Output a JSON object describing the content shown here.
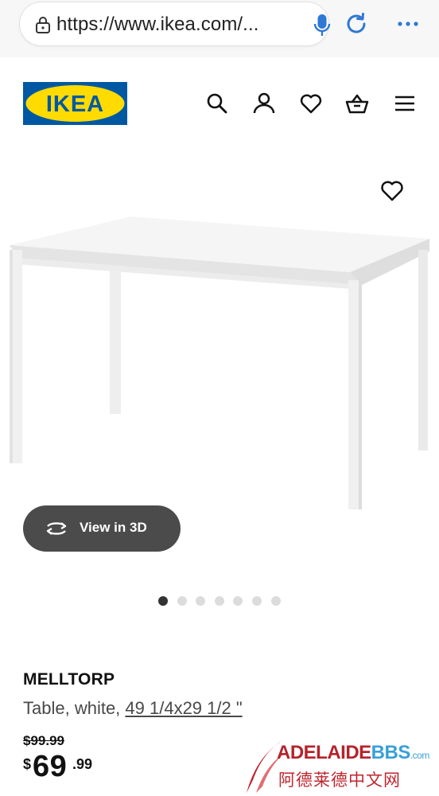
{
  "browser": {
    "url": "https://www.ikea.com/...",
    "icons": [
      "lock-icon",
      "microphone-icon",
      "reload-icon",
      "more-icon"
    ],
    "accent_color": "#2f78d4"
  },
  "header": {
    "logo_text": "IKEA",
    "logo_colors": {
      "blue": "#0058a3",
      "yellow": "#ffdb00"
    },
    "icons": [
      "search-icon",
      "account-icon",
      "favourites-icon",
      "cart-icon",
      "menu-icon"
    ]
  },
  "gallery": {
    "view_3d_label": "View in 3D",
    "dot_count": 7,
    "active_dot": 0
  },
  "product": {
    "name": "MELLTORP",
    "desc_prefix": "Table, white, ",
    "dimensions": "49 1/4x29 1/2 \"",
    "old_price": "$99.99",
    "price": {
      "currency": "$",
      "integer": "69",
      "decimals": ".99"
    }
  },
  "watermark": {
    "brand_a": "ADELAIDE",
    "brand_b": "BBS",
    "brand_suffix": ".com",
    "subtitle": "阿德莱德中文网"
  }
}
